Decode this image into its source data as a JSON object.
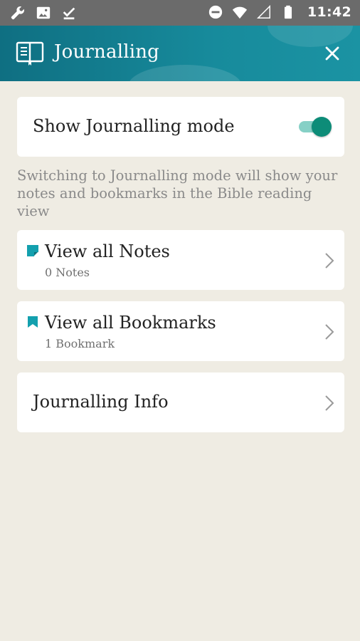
{
  "status_bar": {
    "time": "11:42",
    "left_icons": [
      "wrench-icon",
      "image-icon",
      "download-done-icon"
    ],
    "right_icons": [
      "do-not-disturb-icon",
      "wifi-icon",
      "signal-icon",
      "battery-icon"
    ]
  },
  "app_bar": {
    "title": "Journalling",
    "icon": "journal-icon",
    "close_icon": "close-icon",
    "background_color": "#178b9c"
  },
  "journalling_toggle": {
    "label": "Show Journalling mode",
    "enabled": true,
    "accent_color": "#0d8c78"
  },
  "hint_text": "Switching to Journalling mode will show your notes and bookmarks in the Bible reading view",
  "menu": {
    "notes": {
      "title": "View all Notes",
      "subtitle": "0 Notes",
      "icon": "note-icon"
    },
    "bookmarks": {
      "title": "View all Bookmarks",
      "subtitle": "1 Bookmark",
      "icon": "bookmark-icon"
    },
    "info": {
      "title": "Journalling Info"
    }
  },
  "colors": {
    "page_background": "#efece3",
    "icon_accent": "#13a0ae",
    "secondary_text": "#8a8a8a"
  }
}
